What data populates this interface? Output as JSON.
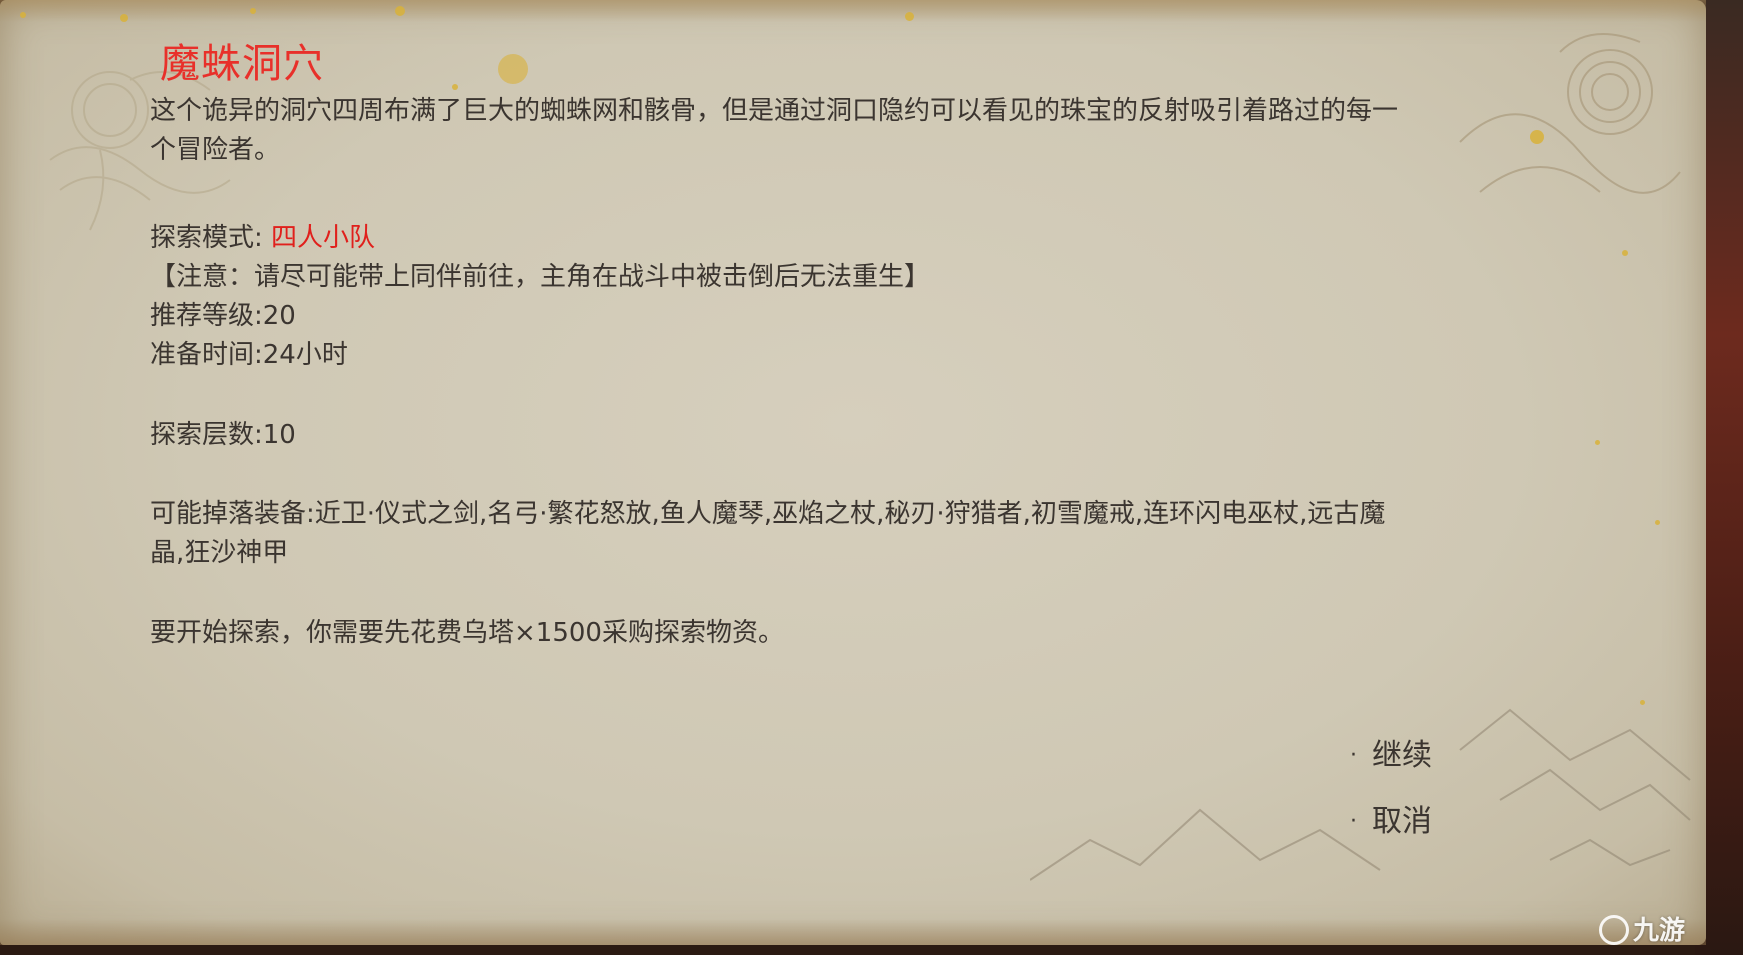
{
  "dialog": {
    "title": "魔蛛洞穴",
    "description": "这个诡异的洞穴四周布满了巨大的蜘蛛网和骸骨，但是通过洞口隐约可以看见的珠宝的反射吸引着路过的每一个冒险者。",
    "description_line1": "这个诡异的洞穴四周布满了巨大的蜘蛛网和骸骨，但是通过洞口隐约可以看见的珠宝的反射吸引着路过的每一",
    "description_line2": "个冒险者。",
    "mode_label": "探索模式: ",
    "mode_value": "四人小队",
    "notice": "【注意：请尽可能带上同伴前往，主角在战斗中被击倒后无法重生】",
    "recommended_level": "推荐等级:20",
    "prep_time": "准备时间:24小时",
    "floors": "探索层数:10",
    "drops_line1": "可能掉落装备:近卫·仪式之剑,名弓·繁花怒放,鱼人魔琴,巫焰之杖,秘刃·狩猎者,初雪魔戒,连环闪电巫杖,远古魔",
    "drops_line2": "晶,狂沙神甲",
    "cost": "要开始探索，你需要先花费乌塔×1500采购探索物资。"
  },
  "options": {
    "bullet": "·",
    "continue": "继续",
    "cancel": "取消"
  },
  "watermark": {
    "text": "九游"
  },
  "colors": {
    "title": "#e8302a",
    "highlight": "#e0201c",
    "body_text": "#3b3530",
    "parchment": "#cfc8b4"
  }
}
